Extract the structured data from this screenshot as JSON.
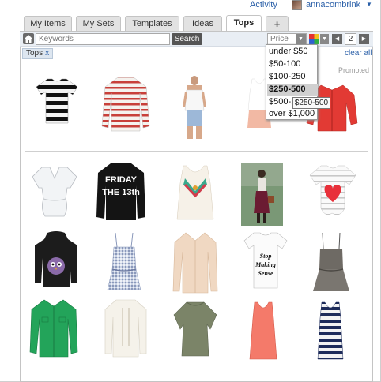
{
  "header": {
    "activity": "Activity",
    "username": "annacombrink"
  },
  "tabs": [
    {
      "label": "My Items"
    },
    {
      "label": "My Sets"
    },
    {
      "label": "Templates"
    },
    {
      "label": "Ideas"
    },
    {
      "label": "Tops"
    },
    {
      "label": "+"
    }
  ],
  "search": {
    "placeholder": "Keywords",
    "button": "Search"
  },
  "price_filter": {
    "label": "Price"
  },
  "pagination": {
    "page": "2"
  },
  "active_filter": {
    "label": "Tops",
    "remove": "x"
  },
  "clear_all": "clear all",
  "promoted": "Promoted",
  "price_options": [
    {
      "label": "under $50"
    },
    {
      "label": "$50-100"
    },
    {
      "label": "$100-250"
    },
    {
      "label": "$250-500"
    },
    {
      "label": "$500-1"
    },
    {
      "label": "over $1,000"
    }
  ],
  "tooltip": "$250-500",
  "colors": {
    "link": "#2a5fa8",
    "tab_bg": "#e2e2e2",
    "toolbar_bg": "#e9eef4",
    "selected_option_bg": "#d0d0d0"
  },
  "products": {
    "promoted_row": [
      {
        "icon": "striped-tshirt"
      },
      {
        "icon": "red-striped-top"
      },
      {
        "icon": "white-tank-top"
      },
      {
        "icon": "peach-tank-top"
      },
      {
        "icon": "red-cardigan"
      }
    ],
    "grid": [
      {
        "icon": "white-blouse"
      },
      {
        "icon": "friday-13th-sweatshirt",
        "text": "FRIDAY THE 13th"
      },
      {
        "icon": "embroidered-tank"
      },
      {
        "icon": "street-style-photo"
      },
      {
        "icon": "heart-print-tee"
      },
      {
        "icon": "owl-hoodie"
      },
      {
        "icon": "gingham-cami"
      },
      {
        "icon": "sheer-blouse"
      },
      {
        "icon": "slogan-tee",
        "text": "Stop Making Sense"
      },
      {
        "icon": "grey-peplum-cami"
      },
      {
        "icon": "green-shirt"
      },
      {
        "icon": "cream-knit-sweater"
      },
      {
        "icon": "olive-knit-top"
      },
      {
        "icon": "coral-tank"
      },
      {
        "icon": "navy-striped-tank"
      }
    ]
  }
}
